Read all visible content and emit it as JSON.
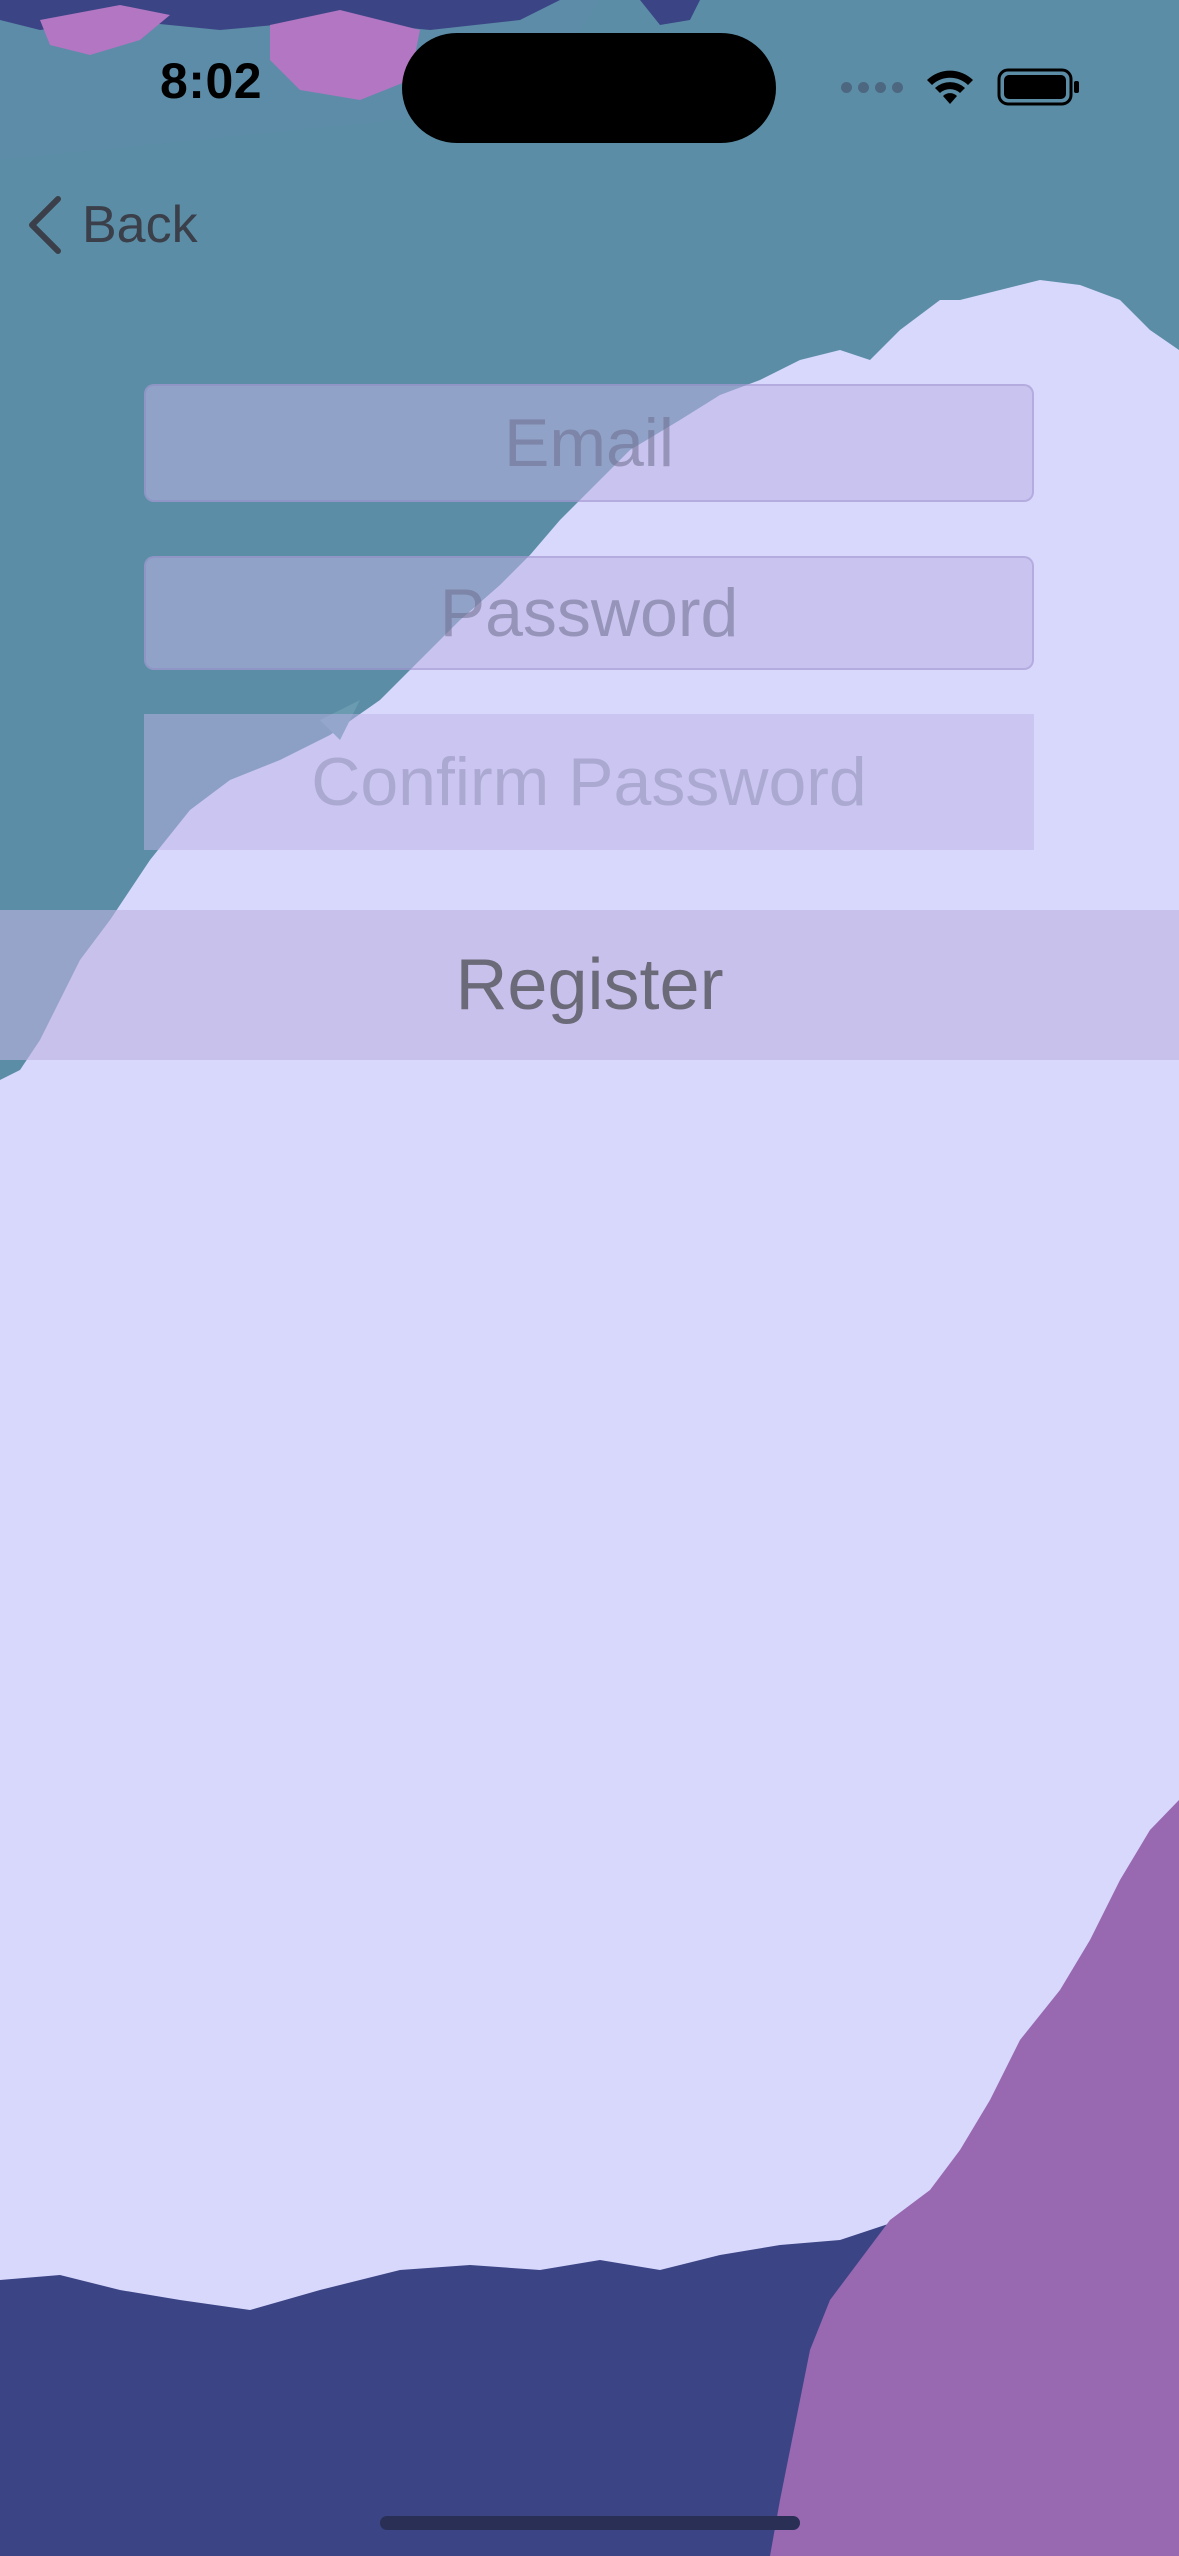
{
  "status_bar": {
    "time": "8:02"
  },
  "nav": {
    "back_label": "Back"
  },
  "form": {
    "email_placeholder": "Email",
    "password_placeholder": "Password",
    "confirm_placeholder": "Confirm Password",
    "register_label": "Register"
  },
  "colors": {
    "background_light": "#d8d8fd",
    "teal_paint": "#5b8ea6",
    "navy_paint": "#3b4585",
    "purple_paint": "#9868b0",
    "pink_paint": "#b276c2"
  }
}
